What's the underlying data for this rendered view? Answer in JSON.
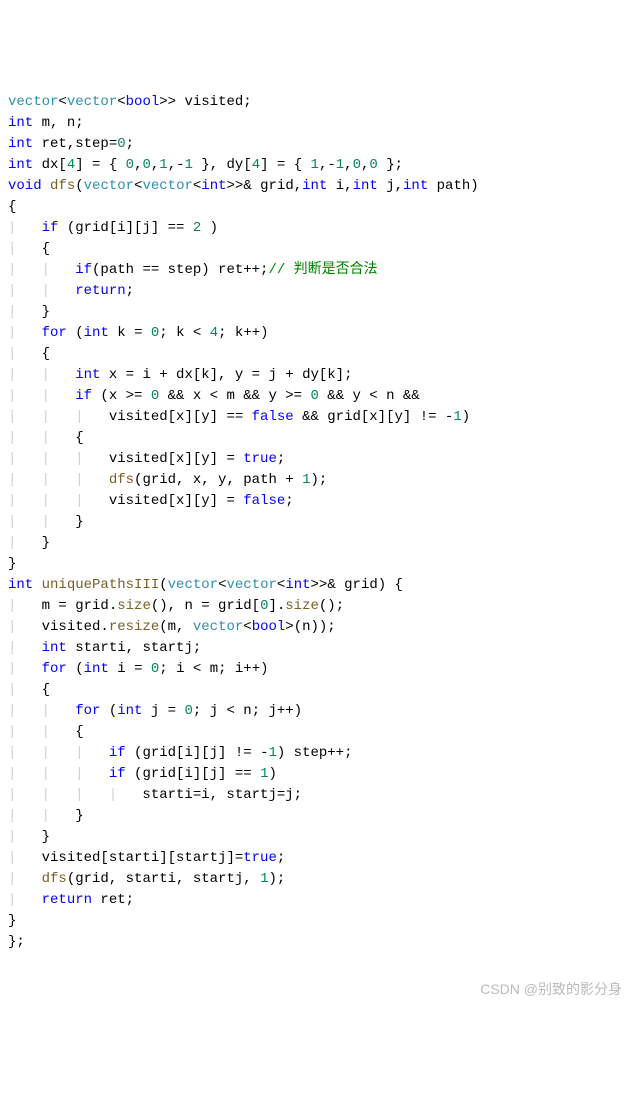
{
  "code": {
    "l1": {
      "t1": "vector",
      "t2": "<",
      "t3": "vector",
      "t4": "<",
      "t5": "bool",
      "t6": ">> visited;"
    },
    "l2": {
      "t1": "int",
      "t2": " m, n;"
    },
    "l3": {
      "t1": "int",
      "t2": " ret,step=",
      "t3": "0",
      "t4": ";"
    },
    "l4": {
      "t1": "int",
      "t2": " dx[",
      "t3": "4",
      "t4": "] = { ",
      "t5": "0",
      "t6": ",",
      "t7": "0",
      "t8": ",",
      "t9": "1",
      "t10": ",-",
      "t11": "1",
      "t12": " }, dy[",
      "t13": "4",
      "t14": "] = { ",
      "t15": "1",
      "t16": ",-",
      "t17": "1",
      "t18": ",",
      "t19": "0",
      "t20": ",",
      "t21": "0",
      "t22": " };"
    },
    "l5": {
      "t1": "void",
      "t2": " ",
      "t3": "dfs",
      "t4": "(",
      "t5": "vector",
      "t6": "<",
      "t7": "vector",
      "t8": "<",
      "t9": "int",
      "t10": ">>& grid,",
      "t11": "int",
      "t12": " i,",
      "t13": "int",
      "t14": " j,",
      "t15": "int",
      "t16": " path)"
    },
    "l6": {
      "t1": "{"
    },
    "l7": {
      "g": "    ",
      "t1": "if",
      "t2": " (grid[i][j] == ",
      "t3": "2",
      "t4": " )"
    },
    "l8": {
      "g": "    ",
      "t1": "{"
    },
    "l9": {
      "g": "    ",
      "g2": "    ",
      "t1": "if",
      "t2": "(path == step) ret++;",
      "t3": "// 判断是否合法"
    },
    "l10": {
      "g": "    ",
      "g2": "    ",
      "t1": "return",
      "t2": ";"
    },
    "l11": {
      "g": "    ",
      "t1": "}"
    },
    "l12": {
      "g": "    ",
      "t1": "for",
      "t2": " (",
      "t3": "int",
      "t4": " k = ",
      "t5": "0",
      "t6": "; k < ",
      "t7": "4",
      "t8": "; k++)"
    },
    "l13": {
      "g": "    ",
      "t1": "{"
    },
    "l14": {
      "g": "    ",
      "g2": "    ",
      "t1": "int",
      "t2": " x = i + dx[k], y = j + dy[k];"
    },
    "l15": {
      "g": "    ",
      "g2": "    ",
      "t1": "if",
      "t2": " (x >= ",
      "t3": "0",
      "t4": " && x < m && y >= ",
      "t5": "0",
      "t6": " && y < n &&"
    },
    "l16": {
      "g": "    ",
      "g2": "    ",
      "g3": "    ",
      "t1": "visited[x][y] == ",
      "t2": "false",
      "t3": " && grid[x][y] != -",
      "t4": "1",
      "t5": ")"
    },
    "l17": {
      "g": "    ",
      "g2": "    ",
      "t1": "{"
    },
    "l18": {
      "g": "    ",
      "g2": "    ",
      "g3": "    ",
      "t1": "visited[x][y] = ",
      "t2": "true",
      "t3": ";"
    },
    "l19": {
      "g": "    ",
      "g2": "    ",
      "g3": "    ",
      "t1": "dfs",
      "t2": "(grid, x, y, path + ",
      "t3": "1",
      "t4": ");"
    },
    "l20": {
      "g": "    ",
      "g2": "    ",
      "g3": "    ",
      "t1": "visited[x][y] = ",
      "t2": "false",
      "t3": ";"
    },
    "l21": {
      "g": "    ",
      "g2": "    ",
      "t1": "}"
    },
    "l22": {
      "g": "    ",
      "t1": "}"
    },
    "l23": {
      "t1": "}"
    },
    "l24": {
      "t1": "int",
      "t2": " ",
      "t3": "uniquePathsIII",
      "t4": "(",
      "t5": "vector",
      "t6": "<",
      "t7": "vector",
      "t8": "<",
      "t9": "int",
      "t10": ">>& grid) {"
    },
    "l25": {
      "g": "    ",
      "t1": "m = grid.",
      "t2": "size",
      "t3": "(), n = grid[",
      "t4": "0",
      "t5": "].",
      "t6": "size",
      "t7": "();"
    },
    "l26": {
      "g": "    ",
      "t1": "visited.",
      "t2": "resize",
      "t3": "(m, ",
      "t4": "vector",
      "t5": "<",
      "t6": "bool",
      "t7": ">(n));"
    },
    "l27": {
      "g": "    ",
      "t1": "int",
      "t2": " starti, startj;"
    },
    "l28": {
      "g": "    ",
      "t1": "for",
      "t2": " (",
      "t3": "int",
      "t4": " i = ",
      "t5": "0",
      "t6": "; i < m; i++)"
    },
    "l29": {
      "g": "    ",
      "t1": "{"
    },
    "l30": {
      "g": "    ",
      "g2": "    ",
      "t1": "for",
      "t2": " (",
      "t3": "int",
      "t4": " j = ",
      "t5": "0",
      "t6": "; j < n; j++)"
    },
    "l31": {
      "g": "    ",
      "g2": "    ",
      "t1": "{"
    },
    "l32": {
      "g": "    ",
      "g2": "    ",
      "g3": "    ",
      "t1": "if",
      "t2": " (grid[i][j] != -",
      "t3": "1",
      "t4": ") step++;"
    },
    "l33": {
      "g": "    ",
      "g2": "    ",
      "g3": "    ",
      "t1": "if",
      "t2": " (grid[i][j] == ",
      "t3": "1",
      "t4": ")"
    },
    "l34": {
      "g": "    ",
      "g2": "    ",
      "g3": "    ",
      "g4": "    ",
      "t1": "starti=i, startj=j;"
    },
    "l35": {
      "g": "    ",
      "g2": "    ",
      "t1": "}"
    },
    "l36": {
      "g": "    ",
      "t1": "}"
    },
    "l37": {
      "g": "    ",
      "t1": "visited[starti][startj]=",
      "t2": "true",
      "t3": ";"
    },
    "l38": {
      "g": "    ",
      "t1": "dfs",
      "t2": "(grid, starti, startj, ",
      "t3": "1",
      "t4": ");"
    },
    "l39": {
      "g": "    ",
      "t1": "return",
      "t2": " ret;"
    },
    "l40": {
      "t1": "}"
    },
    "l41": {
      "t1": "};"
    }
  },
  "watermark": "CSDN @别致的影分身"
}
